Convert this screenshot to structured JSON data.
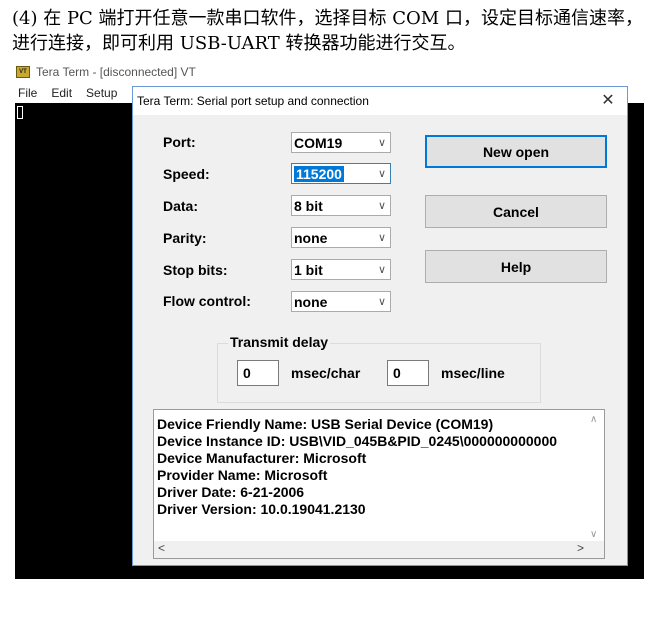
{
  "document": {
    "paragraph": "(4) 在 PC 端打开任意一款串口软件，选择目标 COM 口，设定目标通信速率，进行连接，即可利用 USB-UART 转换器功能进行交互。"
  },
  "vt_window": {
    "icon_text": "VT",
    "title": "Tera Term - [disconnected] VT",
    "menu": [
      "File",
      "Edit",
      "Setup"
    ]
  },
  "dialog": {
    "title": "Tera Term: Serial port setup and connection",
    "close_glyph": "✕",
    "labels": {
      "port": "Port:",
      "speed": "Speed:",
      "data": "Data:",
      "parity": "Parity:",
      "stop_bits": "Stop bits:",
      "flow_control": "Flow control:"
    },
    "values": {
      "port": "COM19",
      "speed": "115200",
      "data": "8 bit",
      "parity": "none",
      "stop_bits": "1 bit",
      "flow_control": "none"
    },
    "buttons": {
      "new_open": "New open",
      "cancel": "Cancel",
      "help": "Help"
    },
    "transmit_delay": {
      "legend": "Transmit delay",
      "char_value": "0",
      "char_unit": "msec/char",
      "line_value": "0",
      "line_unit": "msec/line"
    },
    "device_info": [
      "Device Friendly Name: USB Serial Device (COM19)",
      "Device Instance ID: USB\\VID_045B&PID_0245\\000000000000",
      "Device Manufacturer: Microsoft",
      "Provider Name: Microsoft",
      "Driver Date: 6-21-2006",
      "Driver Version: 10.0.19041.2130"
    ]
  }
}
